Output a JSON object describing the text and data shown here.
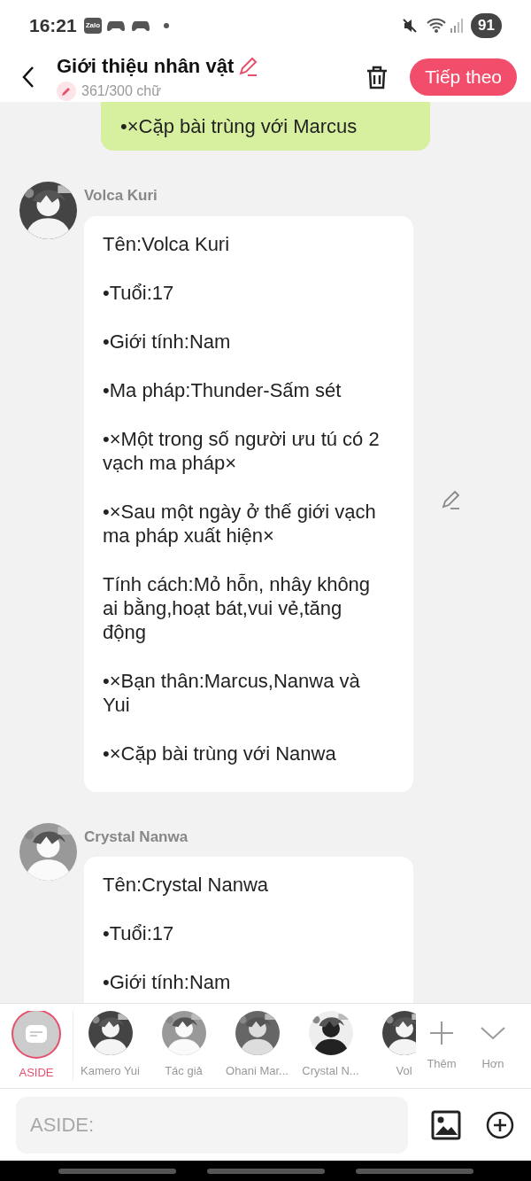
{
  "status_bar": {
    "time": "16:21",
    "app_badge": "Zalo",
    "battery": "91"
  },
  "header": {
    "title": "Giới thiệu nhân vật",
    "word_count": "361/300 chữ",
    "next_button": "Tiếp theo"
  },
  "messages": [
    {
      "kind": "note",
      "paragraphs": [
        "•×Cặp bài trùng với Marcus"
      ]
    },
    {
      "kind": "character",
      "name": "Volca Kuri",
      "editable": true,
      "paragraphs": [
        "Tên:Volca Kuri",
        "•Tuổi:17",
        "•Giới tính:Nam",
        "•Ma pháp:Thunder-Sấm sét",
        "•×Một trong số người ưu tú có 2 vạch ma pháp×",
        "•×Sau một ngày ở thế giới vạch ma pháp xuất hiện×",
        "Tính cách:Mỏ hỗn, nhây không ai bằng,hoạt bát,vui vẻ,tăng động",
        "•×Bạn thân:Marcus,Nanwa và Yui",
        "•×Cặp bài trùng với Nanwa"
      ]
    },
    {
      "kind": "character",
      "name": "Crystal Nanwa",
      "editable": false,
      "paragraphs": [
        "Tên:Crystal Nanwa",
        "•Tuổi:17",
        "•Giới tính:Nam"
      ]
    }
  ],
  "characters": [
    {
      "kind": "aside",
      "label": "ASIDE",
      "selected": true
    },
    {
      "kind": "avatar",
      "label": "Kamero Yui",
      "selected": false
    },
    {
      "kind": "avatar",
      "label": "Tác giả",
      "selected": false
    },
    {
      "kind": "avatar",
      "label": "Ohani Mar...",
      "selected": false
    },
    {
      "kind": "avatar",
      "label": "Crystal N...",
      "selected": false
    },
    {
      "kind": "avatar",
      "label": "Vol",
      "selected": false
    }
  ],
  "actions": [
    "Thêm",
    "Hơn"
  ],
  "composer": {
    "placeholder": "ASIDE:"
  }
}
